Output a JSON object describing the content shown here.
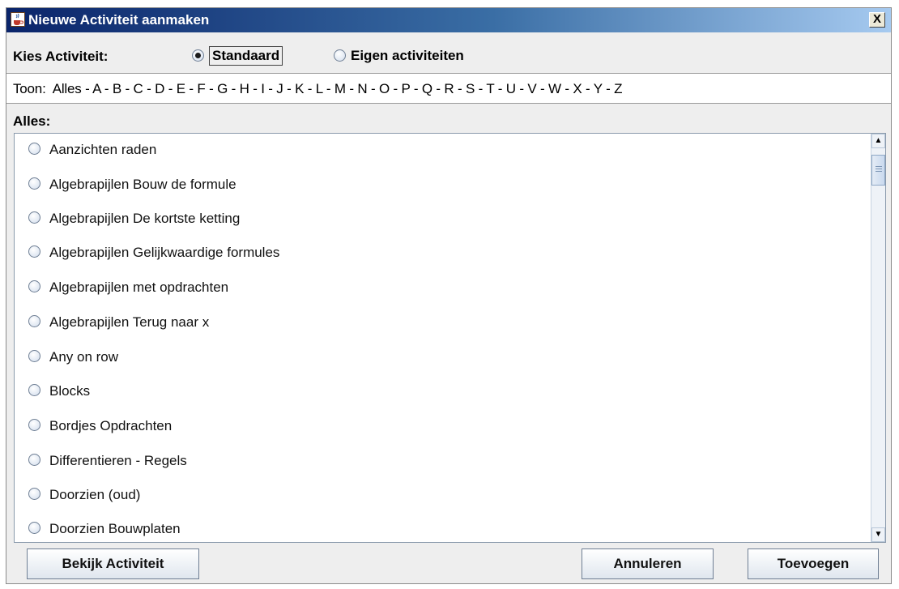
{
  "window": {
    "title": "Nieuwe Activiteit aanmaken",
    "close_symbol": "X"
  },
  "kies": {
    "label": "Kies Activiteit:",
    "options": [
      {
        "label": "Standaard",
        "selected": true
      },
      {
        "label": "Eigen activiteiten",
        "selected": false
      }
    ]
  },
  "toon": {
    "label": "Toon:",
    "filters": [
      "Alles",
      "A",
      "B",
      "C",
      "D",
      "E",
      "F",
      "G",
      "H",
      "I",
      "J",
      "K",
      "L",
      "M",
      "N",
      "O",
      "P",
      "Q",
      "R",
      "S",
      "T",
      "U",
      "V",
      "W",
      "X",
      "Y",
      "Z"
    ],
    "separator": " - "
  },
  "list": {
    "heading": "Alles:",
    "items": [
      "Aanzichten raden",
      "Algebrapijlen Bouw de formule",
      "Algebrapijlen De kortste ketting",
      "Algebrapijlen Gelijkwaardige formules",
      "Algebrapijlen met opdrachten",
      "Algebrapijlen Terug naar x",
      "Any on row",
      "Blocks",
      "Bordjes Opdrachten",
      "Differentieren - Regels",
      "Doorzien (oud)",
      "Doorzien Bouwplaten"
    ]
  },
  "buttons": {
    "bekijk": "Bekijk Activiteit",
    "annuleren": "Annuleren",
    "toevoegen": "Toevoegen"
  },
  "icons": {
    "window_icon": "java-cup-icon",
    "close_icon": "close-icon",
    "scroll_up": "scroll-up-arrow-icon",
    "scroll_down": "scroll-down-arrow-icon"
  }
}
